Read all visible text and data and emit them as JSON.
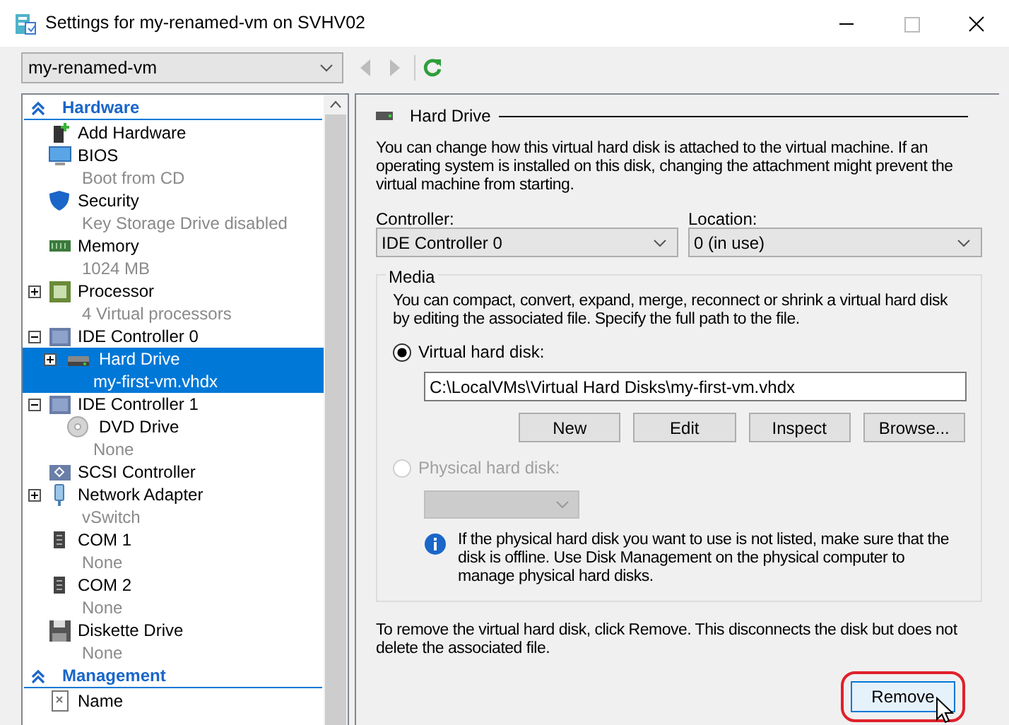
{
  "window": {
    "title": "Settings for my-renamed-vm on SVHV02"
  },
  "toolbar": {
    "vm_select": {
      "value": "my-renamed-vm"
    },
    "back": {
      "disabled": true
    },
    "forward": {
      "disabled": true
    }
  },
  "sidebar": {
    "sections": [
      {
        "title": "Hardware",
        "expanded": true,
        "items": [
          {
            "kind": "add-hardware",
            "label": "Add Hardware",
            "selected": false
          },
          {
            "kind": "bios",
            "label": "BIOS",
            "sublabel": "Boot from CD",
            "selected": false
          },
          {
            "kind": "security",
            "label": "Security",
            "sublabel": "Key Storage Drive disabled",
            "selected": false
          },
          {
            "kind": "memory",
            "label": "Memory",
            "sublabel": "1024 MB",
            "selected": false
          },
          {
            "kind": "processor",
            "label": "Processor",
            "sublabel": "4 Virtual processors",
            "expanded": false,
            "selected": false
          },
          {
            "kind": "controller",
            "label": "IDE Controller 0",
            "expanded": true,
            "selected": false,
            "children": [
              {
                "kind": "hard-drive",
                "label": "Hard Drive",
                "sublabel": "my-first-vm.vhdx",
                "expanded": false,
                "selected": true
              }
            ]
          },
          {
            "kind": "controller",
            "label": "IDE Controller 1",
            "expanded": true,
            "selected": false,
            "children": [
              {
                "kind": "dvd",
                "label": "DVD Drive",
                "sublabel": "None",
                "selected": false
              }
            ]
          },
          {
            "kind": "scsi",
            "label": "SCSI Controller",
            "selected": false
          },
          {
            "kind": "network",
            "label": "Network Adapter",
            "sublabel": "vSwitch",
            "expanded": false,
            "selected": false
          },
          {
            "kind": "com",
            "label": "COM 1",
            "sublabel": "None",
            "selected": false
          },
          {
            "kind": "com",
            "label": "COM 2",
            "sublabel": "None",
            "selected": false
          },
          {
            "kind": "diskette",
            "label": "Diskette Drive",
            "sublabel": "None",
            "selected": false
          }
        ]
      },
      {
        "title": "Management",
        "expanded": true,
        "items": [
          {
            "kind": "name",
            "label": "Name",
            "selected": false
          }
        ]
      }
    ]
  },
  "panel": {
    "title": "Hard Drive",
    "description": "You can change how this virtual hard disk is attached to the virtual machine. If an operating system is installed on this disk, changing the attachment might prevent the virtual machine from starting.",
    "controller": {
      "label": "Controller:",
      "value": "IDE Controller 0"
    },
    "location": {
      "label": "Location:",
      "value": "0 (in use)"
    },
    "media": {
      "title": "Media",
      "description": "You can compact, convert, expand, merge, reconnect or shrink a virtual hard disk by editing the associated file. Specify the full path to the file.",
      "options": [
        {
          "kind": "virtual",
          "label": "Virtual hard disk:",
          "selected": true,
          "disabled": false,
          "path": "C:\\LocalVMs\\Virtual Hard Disks\\my-first-vm.vhdx",
          "buttons": [
            "New",
            "Edit",
            "Inspect",
            "Browse..."
          ]
        },
        {
          "kind": "physical",
          "label": "Physical hard disk:",
          "selected": false,
          "disabled": true
        }
      ],
      "info": "If the physical hard disk you want to use is not listed, make sure that the disk is offline. Use Disk Management on the physical computer to manage physical hard disks."
    },
    "remove_note": "To remove the virtual hard disk, click Remove. This disconnects the disk but does not delete the associated file.",
    "remove_button": {
      "label": "Remove",
      "highlighted": true,
      "hovered": true
    }
  }
}
